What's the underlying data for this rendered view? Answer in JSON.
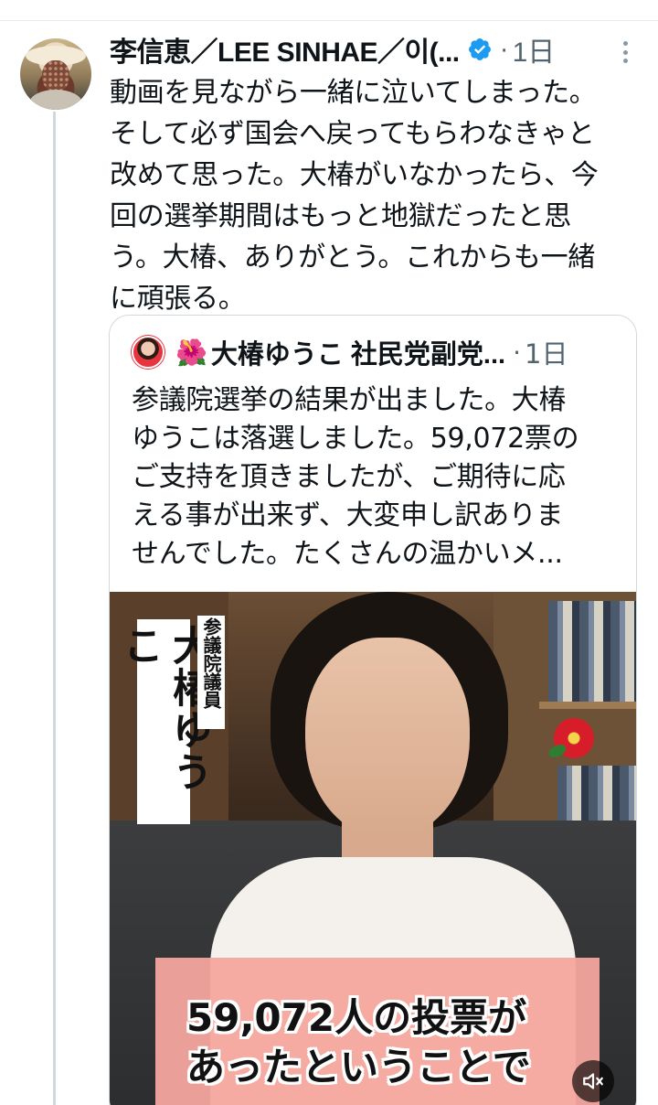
{
  "tweet": {
    "display_name": "李信恵／LEE SINHAE／이(...",
    "dot": "·",
    "timestamp": "1日",
    "verified_icon": "verified-badge-icon",
    "more_icon": "more-dots-icon",
    "text_lines": [
      "動画を見ながら一緒に泣いてしまった。",
      "そして必ず国会へ戻ってもらわなきゃと",
      "改めて思った。大椿がいなかったら、今",
      "回の選挙期間はもっと地獄だったと思",
      "う。大椿、ありがとう。これからも一緒",
      "に頑張る。"
    ]
  },
  "quote": {
    "emoji": "🌺",
    "display_name": "大椿ゆうこ 社民党副党...",
    "dot": "·",
    "timestamp": "1日",
    "text_lines": [
      "参議院選挙の結果が出ました。大椿",
      "ゆうこは落選しました。59,072票の",
      "ご支持を頂きましたが、ご期待に応",
      "える事が出来ず、大変申し訳ありま",
      "せんでした。たくさんの温かいメ..."
    ],
    "video": {
      "name_vertical": "大椿ゆうこ",
      "title_vertical": "参議院議員",
      "caption_lines": [
        "59,072人の投票が",
        "あったということで"
      ],
      "mute_icon": "volume-muted-icon"
    }
  },
  "colors": {
    "text": "#0f1419",
    "secondary": "#536471",
    "verified": "#1d9bf0",
    "border": "#cfd9de"
  }
}
